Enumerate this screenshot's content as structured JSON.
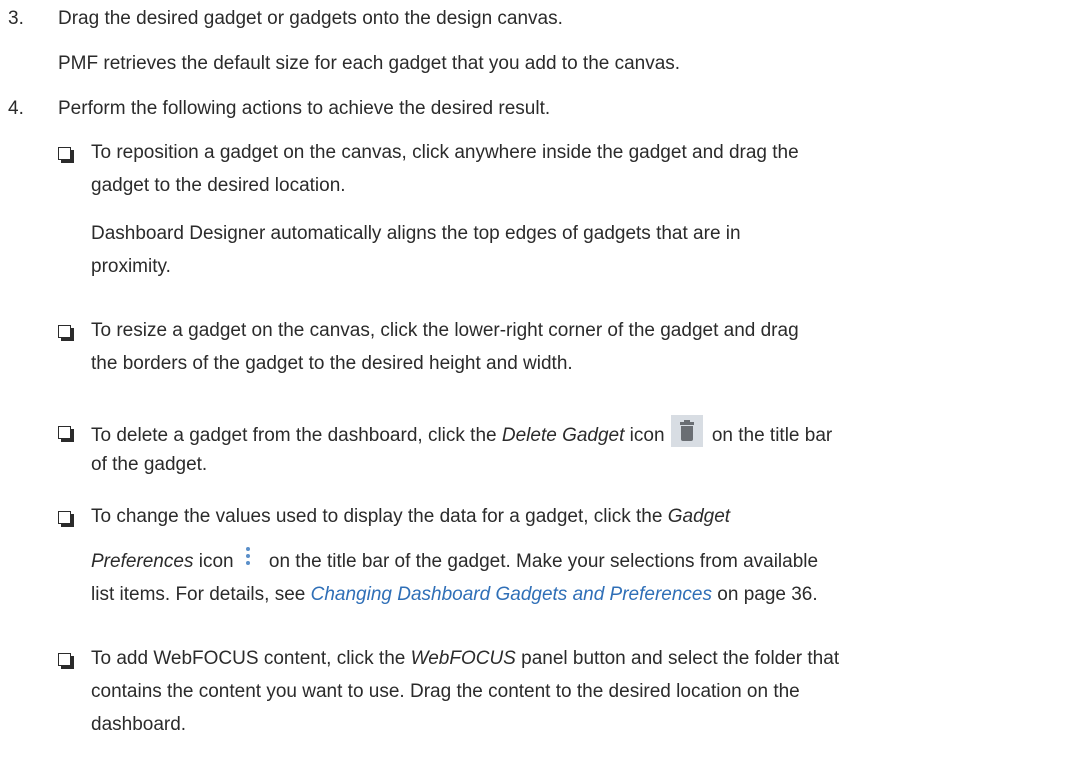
{
  "steps": [
    {
      "number": "3.",
      "text": "Drag the desired gadget or gadgets onto the design canvas.",
      "note": "PMF retrieves the default size for each gadget that you add to the canvas."
    },
    {
      "number": "4.",
      "text": "Perform the following actions to achieve the desired result."
    }
  ],
  "bullets": {
    "reposition": {
      "line1": "To reposition a gadget on the canvas, click anywhere inside the gadget and drag the",
      "line2": "gadget to the desired location.",
      "note_line1": "Dashboard Designer automatically aligns the top edges of gadgets that are in",
      "note_line2": "proximity."
    },
    "resize": {
      "line1": "To resize a gadget on the canvas, click the lower-right corner of the gadget and drag",
      "line2": "the borders of the gadget to the desired height and width."
    },
    "delete": {
      "prefix": "To delete a gadget from the dashboard, click the ",
      "em": "Delete Gadget",
      "mid": " icon",
      "suffix": " on the title bar",
      "line2": "of the gadget.",
      "icon": "trash-icon"
    },
    "preferences": {
      "line1_prefix": "To change the values used to display the data for a gadget, click the ",
      "line1_em": "Gadget",
      "line2_em": "Preferences",
      "line2_mid": " icon",
      "line2_suffix": " on the title bar of the gadget. Make your selections from available",
      "line3_prefix": "list items. For details, see ",
      "line3_link": "Changing Dashboard Gadgets and Preferences",
      "line3_suffix": " on page 36.",
      "icon": "vertical-dots-icon",
      "link_color": "#2f6fb7"
    },
    "webfocus": {
      "line1_prefix": "To add WebFOCUS content, click the ",
      "line1_em": "WebFOCUS",
      "line1_suffix": " panel button and select the folder that",
      "line2": "contains the content you want to use. Drag the content to the desired location on the",
      "line3": "dashboard."
    }
  }
}
